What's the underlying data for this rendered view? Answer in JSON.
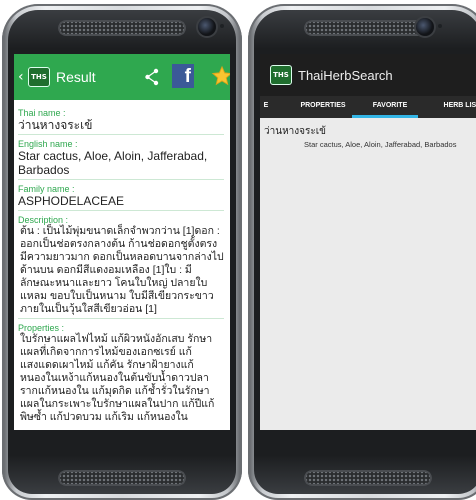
{
  "left": {
    "actionbar": {
      "logo": "THS",
      "title": "Result",
      "bg": "#2fa84f"
    },
    "fields": [
      {
        "label": "Thai name :",
        "value": "ว่านหางจระเข้"
      },
      {
        "label": "English name :",
        "value": "Star cactus, Aloe, Aloin, Jafferabad, Barbados"
      },
      {
        "label": "Family name :",
        "value": "ASPHODELACEAE"
      },
      {
        "label": "Description :",
        "value": "ต้น : เป็นไม้พุ่มขนาดเล็กจำพวกว่าน [1]ดอก : ออกเป็นช่อตรงกลางต้น ก้านช่อดอกชูตั้งตรงมีความยาวมาก ดอกเป็นหลอดบานจากล่างไปด้านบน ดอกมีสีแดงอมเหลือง [1]ใบ : มีลักษณะหนาและยาว โคนใบใหญ่ ปลายใบแหลม ขอบใบเป็นหนาม ใบมีสีเขียวกระขาว ภายในเป็นวุ้นใสสีเขียวอ่อน [1]"
      },
      {
        "label": "Properties :",
        "value": "ใบรักษาแผลไฟไหม้ แก้ผิวหนังอักเสบ รักษาแผลที่เกิดจากการไหม้ของเอกซเรย์ แก้แสงแดดเผาไหม้ แก้คัน รักษาฝ้ายางแก้หนองในเหง้าแก้หนองในต้นขับน้ำดาวปลารากแก้หนองใน แก้มุดกิด แก้ช้ำรั่วในรักษาแผลในกระเพาะใบรักษาแผลในปาก แก้ปีแก้พิษซ้ำ แก้ปวดบวม แก้เริม แก้หนองใน"
      }
    ]
  },
  "right": {
    "actionbar": {
      "logo": "THS",
      "title": "ThaiHerbSearch",
      "bg": "#1e1e1e"
    },
    "tabs": {
      "partial": "E",
      "properties": "PROPERTIES",
      "favorite": "FAVORITE",
      "herb_list": "HERB LIST",
      "active": "FAVORITE",
      "accent": "#33b5e5"
    },
    "favorites": [
      {
        "thai": "ว่านหางจระเข้",
        "english": "Star cactus, Aloe, Aloin, Jafferabad, Barbados"
      }
    ]
  }
}
